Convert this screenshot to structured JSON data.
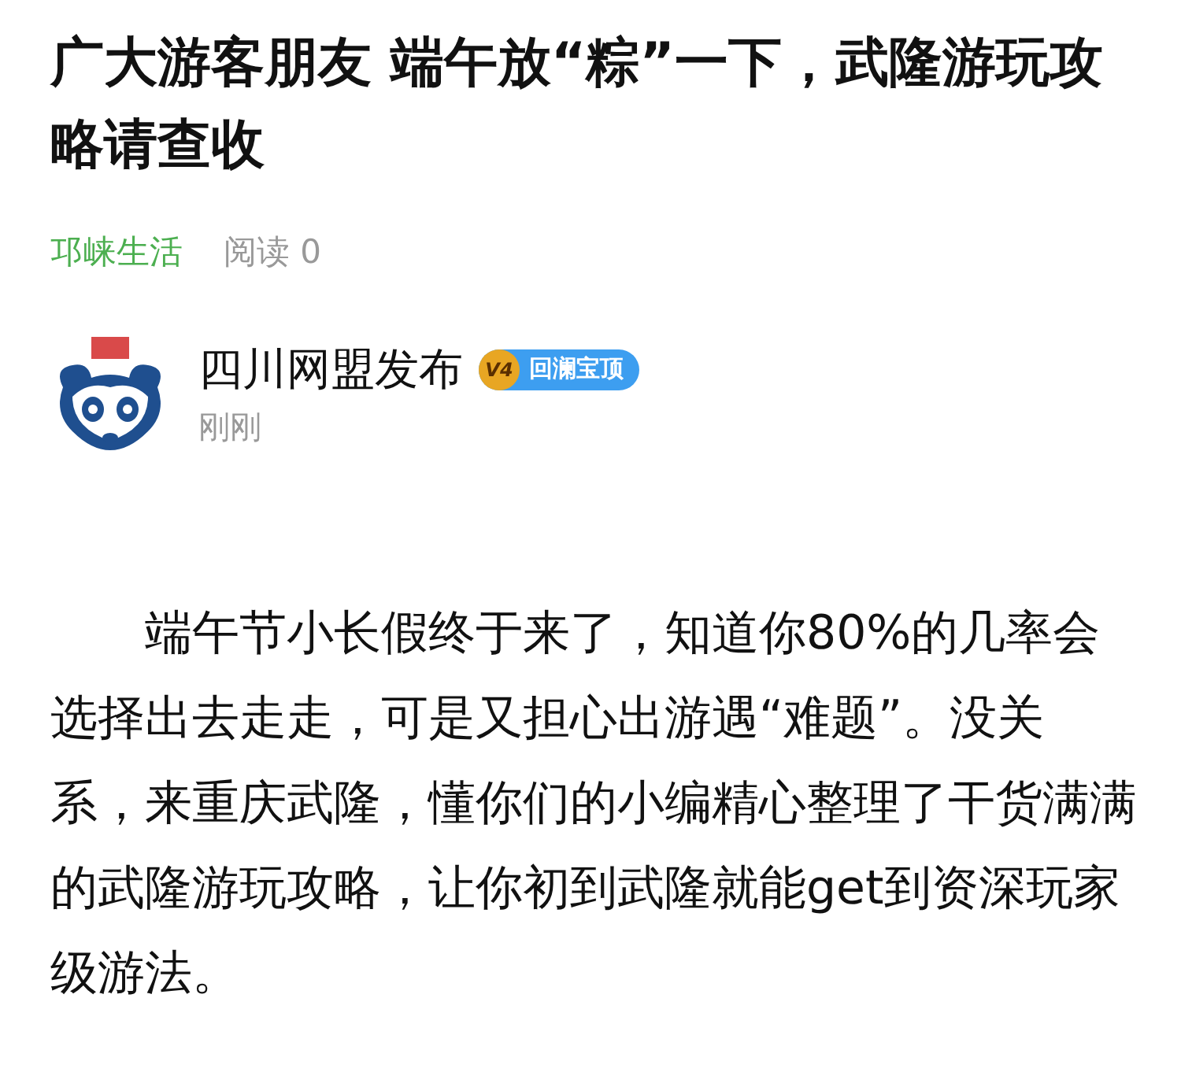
{
  "article": {
    "title": "广大游客朋友 端午放“粽”一下，武隆游玩攻略请查收",
    "source": "邛崃生活",
    "reads": "阅读 0"
  },
  "author": {
    "name": "四川网盟发布",
    "level_badge": "V4",
    "honor_badge": "回澜宝顶",
    "time": "刚刚"
  },
  "body": [
    "端午节小长假终于来了，知道你80%的几率会选择出去走走，可是又担心出游遇“难题”。没关系，来重庆武隆，懂你们的小编精心整理了干货满满的武隆游玩攻略，让你初到武隆就能get到资深玩家级游法。"
  ]
}
